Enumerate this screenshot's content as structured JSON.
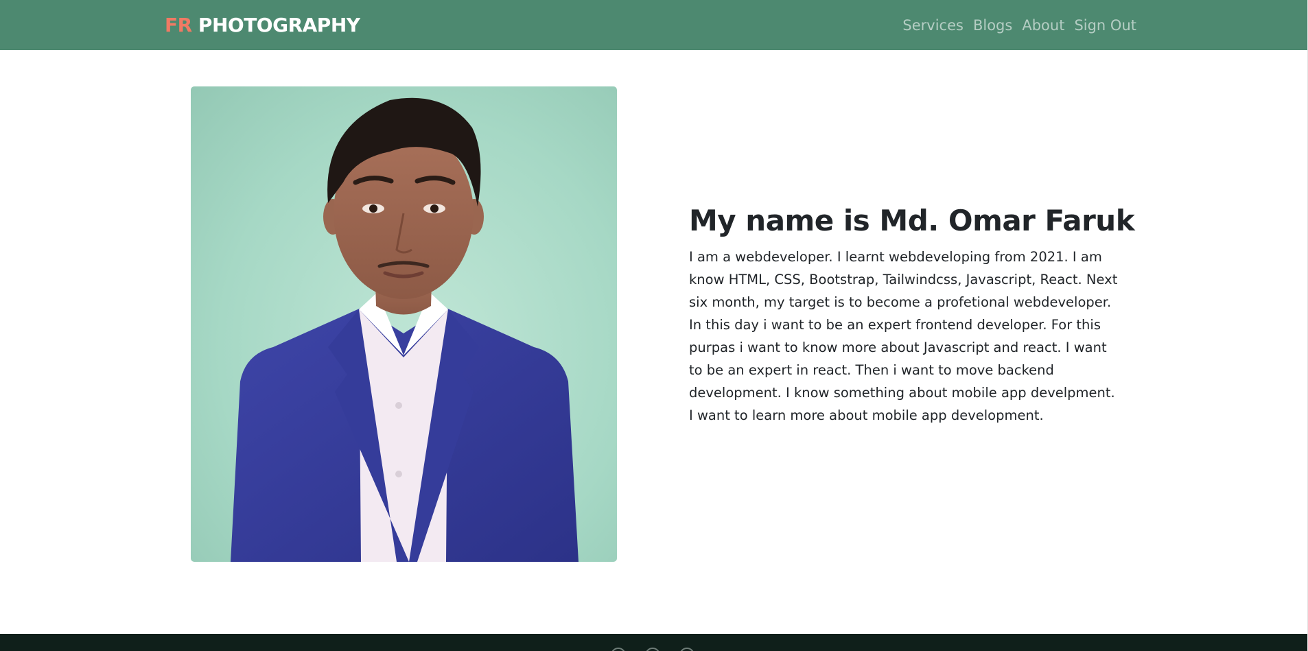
{
  "navbar": {
    "brand_accent": "FR",
    "brand_rest": " PHOTOGRAPHY",
    "links": [
      "Services",
      "Blogs",
      "About",
      "Sign Out"
    ]
  },
  "profile": {
    "title": "My name is Md. Omar Faruk",
    "description": "I am a webdeveloper. I learnt webdeveloping from 2021. I am know HTML, CSS, Bootstrap, Tailwindcss, Javascript, React. Next six month, my target is to become a profetional webdeveloper. In this day i want to be an expert frontend developer. For this purpas i want to know more about Javascript and react. I want to be an expert in react. Then i want to move backend development. I know something about mobile app develpment. I want to learn more about mobile app development."
  },
  "colors": {
    "navbar_bg": "#4d8970",
    "brand_accent": "#f07a64",
    "footer_bg": "#0f1f1a",
    "text": "#212529"
  },
  "footer": {
    "icons": [
      "social-icon",
      "social-icon",
      "social-icon"
    ]
  }
}
